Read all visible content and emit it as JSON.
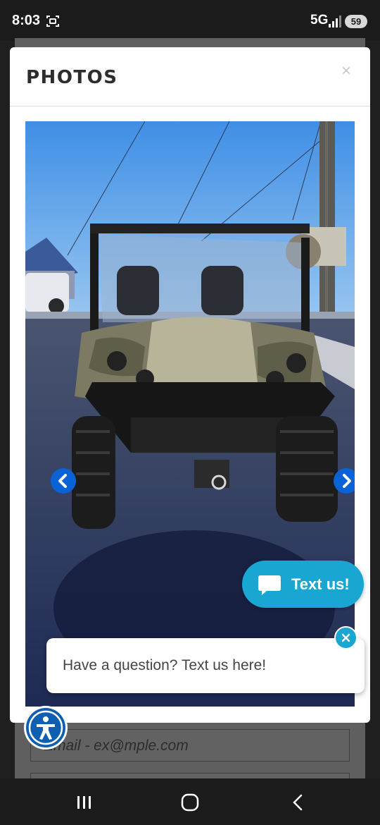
{
  "status_bar": {
    "time": "8:03",
    "network": "5G",
    "battery": "59"
  },
  "modal": {
    "title": "PHOTOS",
    "close_glyph": "×"
  },
  "photo": {
    "prev_icon": "chevron-left-icon",
    "next_icon": "chevron-right-icon"
  },
  "text_us": {
    "label": "Text us!",
    "icon": "chat-bubble-icon",
    "color": "#1aa6d3"
  },
  "chat_popup": {
    "message": "Have a question? Text us here!",
    "close_icon": "close-icon"
  },
  "background_form": {
    "email_placeholder": "Email - ex@mple.com"
  },
  "accessibility": {
    "icon": "accessibility-icon",
    "color": "#0f5fb0"
  },
  "nav_bar": {
    "recents_icon": "recents-icon",
    "home_icon": "home-icon",
    "back_icon": "back-icon"
  }
}
